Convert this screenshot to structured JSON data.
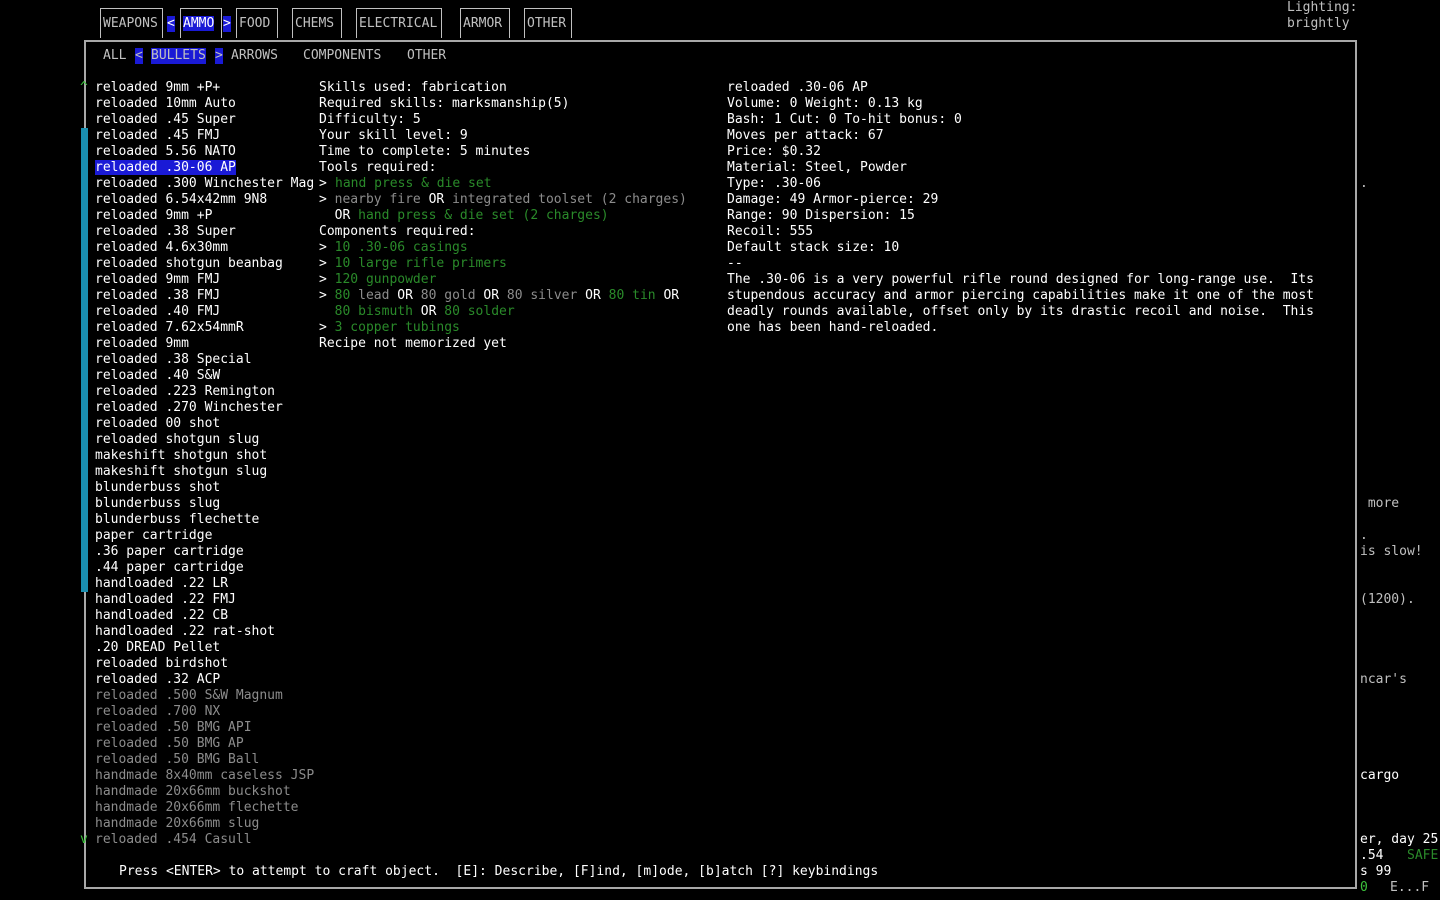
{
  "category_tabs": [
    {
      "label": "WEAPONS",
      "active": false
    },
    {
      "label": "AMMO",
      "active": true
    },
    {
      "label": "FOOD",
      "active": false
    },
    {
      "label": "CHEMS",
      "active": false
    },
    {
      "label": "ELECTRICAL",
      "active": false
    },
    {
      "label": "ARMOR",
      "active": false
    },
    {
      "label": "OTHER",
      "active": false
    }
  ],
  "tab_arrows": {
    "left": "<",
    "right": ">"
  },
  "subcategories": [
    {
      "label": "ALL",
      "active": false
    },
    {
      "label": "BULLETS",
      "active": true
    },
    {
      "label": "ARROWS",
      "active": false
    },
    {
      "label": "COMPONENTS",
      "active": false
    },
    {
      "label": "OTHER",
      "active": false
    }
  ],
  "scroll_indicators": {
    "up": "^",
    "down": "v"
  },
  "recipes": [
    {
      "name": "reloaded 9mm +P+",
      "craftable": true
    },
    {
      "name": "reloaded 10mm Auto",
      "craftable": true
    },
    {
      "name": "reloaded .45 Super",
      "craftable": true
    },
    {
      "name": "reloaded .45 FMJ",
      "craftable": true
    },
    {
      "name": "reloaded 5.56 NATO",
      "craftable": true
    },
    {
      "name": "reloaded .30-06 AP",
      "craftable": true,
      "selected": true
    },
    {
      "name": "reloaded .300 Winchester Mag",
      "craftable": true
    },
    {
      "name": "reloaded 6.54x42mm 9N8",
      "craftable": true
    },
    {
      "name": "reloaded 9mm +P",
      "craftable": true
    },
    {
      "name": "reloaded .38 Super",
      "craftable": true
    },
    {
      "name": "reloaded 4.6x30mm",
      "craftable": true
    },
    {
      "name": "reloaded shotgun beanbag",
      "craftable": true
    },
    {
      "name": "reloaded 9mm FMJ",
      "craftable": true
    },
    {
      "name": "reloaded .38 FMJ",
      "craftable": true
    },
    {
      "name": "reloaded .40 FMJ",
      "craftable": true
    },
    {
      "name": "reloaded 7.62x54mmR",
      "craftable": true
    },
    {
      "name": "reloaded 9mm",
      "craftable": true
    },
    {
      "name": "reloaded .38 Special",
      "craftable": true
    },
    {
      "name": "reloaded .40 S&W",
      "craftable": true
    },
    {
      "name": "reloaded .223 Remington",
      "craftable": true
    },
    {
      "name": "reloaded .270 Winchester",
      "craftable": true
    },
    {
      "name": "reloaded 00 shot",
      "craftable": true
    },
    {
      "name": "reloaded shotgun slug",
      "craftable": true
    },
    {
      "name": "makeshift shotgun shot",
      "craftable": true
    },
    {
      "name": "makeshift shotgun slug",
      "craftable": true
    },
    {
      "name": "blunderbuss shot",
      "craftable": true
    },
    {
      "name": "blunderbuss slug",
      "craftable": true
    },
    {
      "name": "blunderbuss flechette",
      "craftable": true
    },
    {
      "name": "paper cartridge",
      "craftable": true
    },
    {
      "name": ".36 paper cartridge",
      "craftable": true
    },
    {
      "name": ".44 paper cartridge",
      "craftable": true
    },
    {
      "name": "handloaded .22 LR",
      "craftable": true
    },
    {
      "name": "handloaded .22 FMJ",
      "craftable": true
    },
    {
      "name": "handloaded .22 CB",
      "craftable": true
    },
    {
      "name": "handloaded .22 rat-shot",
      "craftable": true
    },
    {
      "name": ".20 DREAD Pellet",
      "craftable": true
    },
    {
      "name": "reloaded birdshot",
      "craftable": true
    },
    {
      "name": "reloaded .32 ACP",
      "craftable": true
    },
    {
      "name": "reloaded .500 S&W Magnum",
      "craftable": false
    },
    {
      "name": "reloaded .700 NX",
      "craftable": false
    },
    {
      "name": "reloaded .50 BMG API",
      "craftable": false
    },
    {
      "name": "reloaded .50 BMG AP",
      "craftable": false
    },
    {
      "name": "reloaded .50 BMG Ball",
      "craftable": false
    },
    {
      "name": "handmade 8x40mm caseless JSP",
      "craftable": false
    },
    {
      "name": "handmade 20x66mm buckshot",
      "craftable": false
    },
    {
      "name": "handmade 20x66mm flechette",
      "craftable": false
    },
    {
      "name": "handmade 20x66mm slug",
      "craftable": false
    },
    {
      "name": "reloaded .454 Casull",
      "craftable": false
    }
  ],
  "requirements": {
    "skills_used": "Skills used: fabrication",
    "required_skills": "Required skills: marksmanship(5)",
    "difficulty": "Difficulty: 5",
    "skill_level": "Your skill level: 9",
    "time": "Time to complete: 5 minutes",
    "tools_header": "Tools required:",
    "tools_line1_prefix": "> ",
    "tools_line1_item": "hand press & die set",
    "tools_line2_prefix": "> ",
    "tools_line2_a": "nearby fire",
    "or": "OR",
    "tools_line2_b": "integrated toolset (2 charges)",
    "tools_line3_item": "hand press & die set (2 charges)",
    "components_header": "Components required:",
    "comp1": "10 .30-06 casings",
    "comp2": "10 large rifle primers",
    "comp3": "120 gunpowder",
    "comp4_qty_a": "80",
    "comp4_a": "lead",
    "comp4_qty_b": "80",
    "comp4_b": "gold",
    "comp4_qty_c": "80",
    "comp4_c": "silver",
    "comp4_qty_d": "80",
    "comp4_d": "tin",
    "comp4_qty_e": "80",
    "comp4_e": "bismuth",
    "comp4_qty_f": "80",
    "comp4_f": "solder",
    "comp5": "3 copper tubings",
    "memorized": "Recipe not memorized yet"
  },
  "item_info": {
    "name": "reloaded .30-06 AP",
    "volume_weight": "Volume: 0 Weight: 0.13 kg",
    "bash_cut": "Bash: 1 Cut: 0 To-hit bonus: 0",
    "moves": "Moves per attack: 67",
    "price": "Price: $0.32",
    "material": "Material: Steel, Powder",
    "type": "Type: .30-06",
    "damage": "Damage: 49 Armor-pierce: 29",
    "range": "Range: 90 Dispersion: 15",
    "recoil": "Recoil: 555",
    "stack": "Default stack size: 10",
    "separator": "--",
    "desc1": "The .30-06 is a very powerful rifle round designed for long-range use.  Its",
    "desc2": "stupendous accuracy and armor piercing capabilities make it one of the most",
    "desc3": "deadly rounds available, offset only by its drastic recoil and noise.  This",
    "desc4": "one has been hand-reloaded."
  },
  "footer": "Press <ENTER> to attempt to craft object.  [E]: Describe, [F]ind, [m]ode, [b]atch [?] keybindings",
  "sidebar": {
    "lighting_label": "Lighting:",
    "lighting_value": "brightly",
    "dot1": ".",
    "more": " more",
    "dot2": ".",
    "is_slow": "is slow!",
    "value_1200": "(1200).",
    "ncar": "ncar's",
    "cargo": "cargo",
    "day": "er, day 25",
    "val54": ".54",
    "safe": "SAFE",
    "s99": "s 99",
    "zero": "0",
    "ef": "E...F"
  },
  "colors": {
    "highlight": "#1a1ad6",
    "component_green": "#2a8a2a",
    "scrollbar": "#1a8fb0",
    "lighting_yellow": "#ffff3c",
    "safe_green": "#2a8a2a"
  }
}
